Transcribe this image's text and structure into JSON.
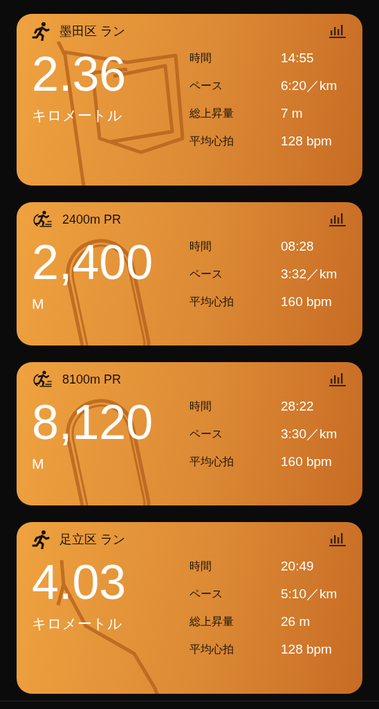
{
  "activities": [
    {
      "kind": "run",
      "title": "墨田区 ラン",
      "distance": "2.36",
      "unit": "キロメートル",
      "stats": [
        {
          "label": "時間",
          "value": "14:55"
        },
        {
          "label": "ペース",
          "value": "6:20／km"
        },
        {
          "label": "総上昇量",
          "value": "7 m"
        },
        {
          "label": "平均心拍",
          "value": "128 bpm"
        }
      ]
    },
    {
      "kind": "track",
      "title": "2400m PR",
      "distance": "2,400",
      "unit": "M",
      "stats": [
        {
          "label": "時間",
          "value": "08:28"
        },
        {
          "label": "ペース",
          "value": "3:32／km"
        },
        {
          "label": "平均心拍",
          "value": "160 bpm"
        }
      ]
    },
    {
      "kind": "track",
      "title": "8100m PR",
      "distance": "8,120",
      "unit": "M",
      "stats": [
        {
          "label": "時間",
          "value": "28:22"
        },
        {
          "label": "ペース",
          "value": "3:30／km"
        },
        {
          "label": "平均心拍",
          "value": "160 bpm"
        }
      ]
    },
    {
      "kind": "run",
      "title": "足立区 ラン",
      "distance": "4.03",
      "unit": "キロメートル",
      "stats": [
        {
          "label": "時間",
          "value": "20:49"
        },
        {
          "label": "ペース",
          "value": "5:10／km"
        },
        {
          "label": "総上昇量",
          "value": "26 m"
        },
        {
          "label": "平均心拍",
          "value": "128 bpm"
        }
      ]
    }
  ]
}
